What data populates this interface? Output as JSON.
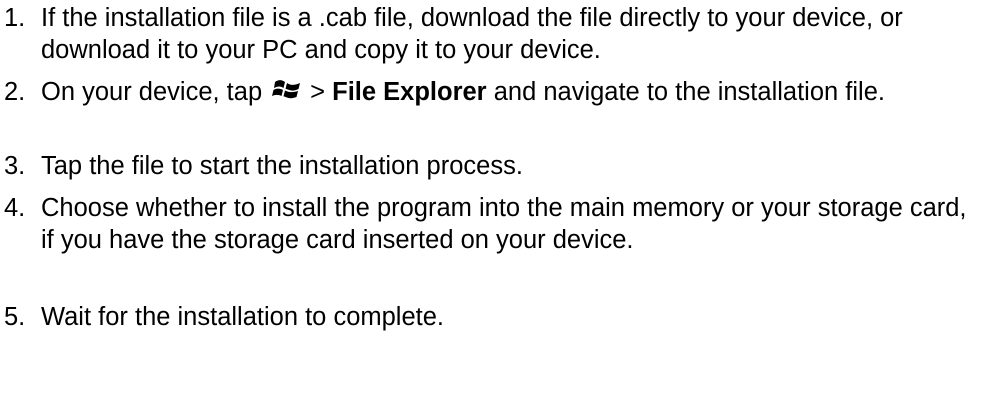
{
  "steps": [
    {
      "number": "1.",
      "text": "If the installation file is a .cab file, download the file directly to your device, or download it to your PC and copy it to your device."
    },
    {
      "number": "2.",
      "prefix": "On your device, tap",
      "icon": "windows-start-icon",
      "separator": ">",
      "bold": "File Explorer",
      "suffix": "and navigate to the installation file."
    },
    {
      "number": "3.",
      "text": "Tap the file to start the installation process."
    },
    {
      "number": "4.",
      "text": "Choose whether to install the program into the main memory or your storage card, if you have the storage card inserted on your device."
    },
    {
      "number": "5.",
      "text": "Wait for the installation to complete."
    }
  ]
}
